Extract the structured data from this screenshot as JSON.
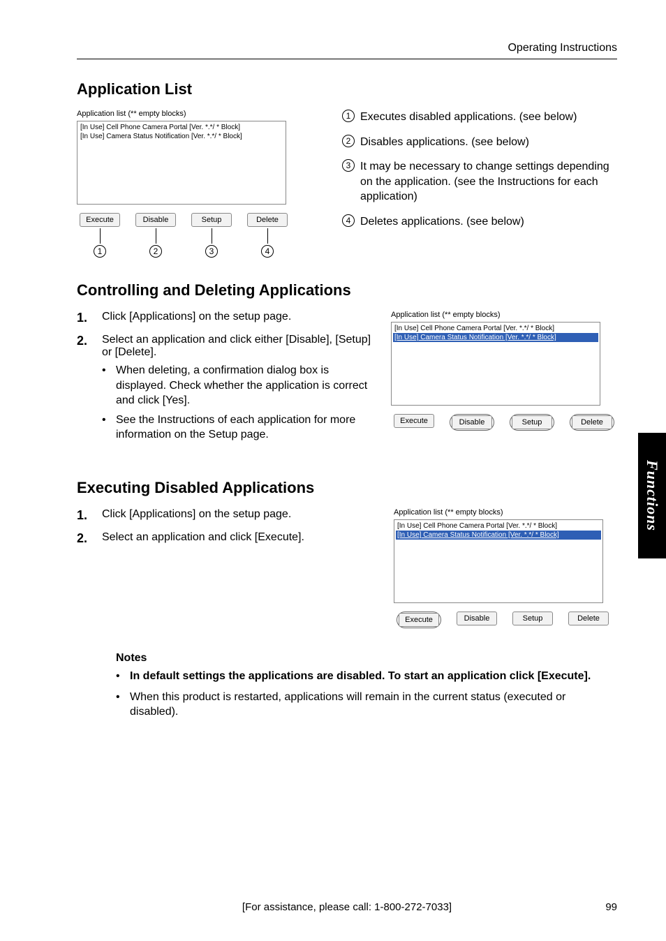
{
  "header": {
    "doc_title": "Operating Instructions"
  },
  "side_tab": "Functions",
  "section1": {
    "title": "Application List",
    "panel": {
      "title": "Application list (** empty blocks)",
      "items": [
        "[In Use]  Cell Phone Camera Portal  [Ver. *.*/ * Block]",
        "[In Use]  Camera Status Notification  [Ver. *.*/ * Block]"
      ],
      "buttons": {
        "b1": "Execute",
        "b2": "Disable",
        "b3": "Setup",
        "b4": "Delete"
      },
      "nums": {
        "n1": "1",
        "n2": "2",
        "n3": "3",
        "n4": "4"
      }
    },
    "descriptions": {
      "d1": "Executes disabled applications. (see below)",
      "d2": "Disables applications. (see below)",
      "d3": "It may be necessary to change settings depending on the application. (see the Instructions for each application)",
      "d4": "Deletes applications. (see below)"
    }
  },
  "section2": {
    "title": "Controlling and Deleting Applications",
    "steps": {
      "s1_num": "1.",
      "s1": "Click [Applications] on the setup page.",
      "s2_num": "2.",
      "s2": "Select an application and click either [Disable], [Setup] or [Delete].",
      "s2_sub1": "When deleting, a confirmation dialog box is displayed. Check whether the application is correct and click [Yes].",
      "s2_sub2": "See the Instructions of each application for more information on the Setup page."
    },
    "panel": {
      "title": "Application list (** empty blocks)",
      "items": [
        "[In Use]  Cell Phone Camera Portal  [Ver. *.*/ * Block]",
        "[In Use]  Camera Status Notification  [Ver. *.*/ * Block]"
      ],
      "buttons": {
        "b1": "Execute",
        "b2": "Disable",
        "b3": "Setup",
        "b4": "Delete"
      }
    }
  },
  "section3": {
    "title": "Executing Disabled Applications",
    "steps": {
      "s1_num": "1.",
      "s1": "Click [Applications] on the setup page.",
      "s2_num": "2.",
      "s2": "Select an application and click [Execute]."
    },
    "panel": {
      "title": "Application list (** empty blocks)",
      "items": [
        "[In Use]  Cell Phone Camera Portal  [Ver. *.*/ * Block]",
        "[In Use]  Camera Status Notification  [Ver. *.*/ * Block]"
      ],
      "buttons": {
        "b1": "Execute",
        "b2": "Disable",
        "b3": "Setup",
        "b4": "Delete"
      }
    }
  },
  "notes": {
    "heading": "Notes",
    "n1": "In default settings the applications are disabled. To start an application click [Execute].",
    "n2": "When this product is restarted, applications will remain in the current status (executed or disabled)."
  },
  "footer": {
    "assist": "[For assistance, please call: 1-800-272-7033]",
    "page": "99"
  }
}
